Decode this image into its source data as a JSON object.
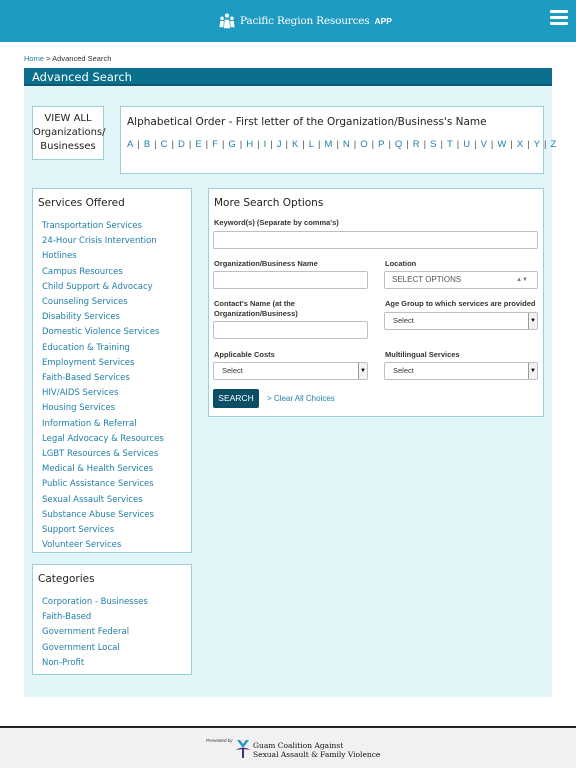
{
  "header": {
    "brand_name": "Pacific Region Resources",
    "brand_app": "APP",
    "color": "#1e9bc1",
    "icons": [
      "people-logo-icon",
      "hamburger-menu-icon"
    ]
  },
  "breadcrumb": {
    "home": "Home",
    "separator": ">",
    "current": "Advanced Search"
  },
  "page_title": "Advanced Search",
  "view_all": {
    "line1": "VIEW ALL",
    "line2": "Organizations/",
    "line3": "Businesses"
  },
  "alphabet": {
    "title": "Alphabetical Order - First letter of the Organization/Business's Name",
    "letters": [
      "A",
      "B",
      "C",
      "D",
      "E",
      "F",
      "G",
      "H",
      "I",
      "J",
      "K",
      "L",
      "M",
      "N",
      "O",
      "P",
      "Q",
      "R",
      "S",
      "T",
      "U",
      "V",
      "W",
      "X",
      "Y",
      "Z"
    ]
  },
  "services": {
    "title": "Services Offered",
    "items": [
      "Transportation Services",
      "24-Hour Crisis Intervention Hotlines",
      "Campus Resources",
      "Child Support & Advocacy",
      "Counseling Services",
      "Disability Services",
      "Domestic Violence Services",
      "Education & Training",
      "Employment Services",
      "Faith-Based Services",
      "HIV/AIDS Services",
      "Housing Services",
      "Information & Referral",
      "Legal Advocacy & Resources",
      "LGBT Resources & Services",
      "Medical & Health Services",
      "Public Assistance Services",
      "Sexual Assault Services",
      "Substance Abuse Services",
      "Support Services",
      "Volunteer Services"
    ]
  },
  "categories": {
    "title": "Categories",
    "items": [
      "Corporation - Businesses",
      "Faith-Based",
      "Government Federal",
      "Government Local",
      "Non-Profit"
    ]
  },
  "more_options": {
    "title": "More Search Options",
    "keywords_label": "Keyword(s) (Separate by comma's)",
    "keywords_value": "",
    "org_name_label": "Organization/Business Name",
    "org_name_value": "",
    "location_label": "Location",
    "location_value": "SELECT OPTIONS",
    "contact_label": "Contact's Name (at the Organization/Business)",
    "contact_value": "",
    "age_label": "Age Group to which services are provided",
    "age_value": "Select",
    "costs_label": "Applicable Costs",
    "costs_value": "Select",
    "multilingual_label": "Multilingual Services",
    "multilingual_value": "Select",
    "search_button": "SEARCH",
    "clear_link": "> Clear All Choices"
  },
  "footer": {
    "presented_by": "Presented by",
    "org_line1": "Guam Coalition Against",
    "org_line2": "Sexual Assault & Family Violence"
  }
}
